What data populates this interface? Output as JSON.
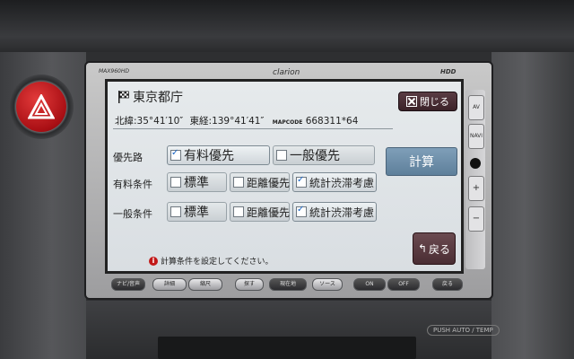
{
  "device": {
    "model": "MAX960HD",
    "brand": "clarion",
    "hdd": "HDD"
  },
  "header": {
    "title": "東京都庁",
    "close_label": "閉じる"
  },
  "location": {
    "lat_label": "北緯:35°41′10″",
    "lon_label": "東経:139°41′41″",
    "mapcode_label": "MAPCODE",
    "mapcode": "668311*64"
  },
  "rows": [
    {
      "label": "優先路",
      "options": [
        {
          "label": "有料優先",
          "checked": true
        },
        {
          "label": "一般優先",
          "checked": false
        }
      ]
    },
    {
      "label": "有料条件",
      "options": [
        {
          "label": "標準",
          "checked": false
        },
        {
          "label": "距離優先",
          "checked": false
        },
        {
          "label": "統計渋滞考慮",
          "checked": true
        }
      ]
    },
    {
      "label": "一般条件",
      "options": [
        {
          "label": "標準",
          "checked": false
        },
        {
          "label": "距離優先",
          "checked": false
        },
        {
          "label": "統計渋滞考慮",
          "checked": true
        }
      ]
    }
  ],
  "actions": {
    "calculate_label": "計算",
    "back_label": "戻る"
  },
  "footer": {
    "message": "計算条件を設定してください。"
  },
  "side_buttons": [
    "AV",
    "NAVI",
    "+",
    "−"
  ],
  "hardware_buttons": [
    "ナビ/音声",
    "詳細",
    "縮尺",
    "探す",
    "現在地",
    "ソース",
    "ON",
    "OFF",
    "戻る"
  ],
  "panel": {
    "push_label": "PUSH AUTO / TEMP"
  },
  "colors": {
    "hazard_red": "#c0141a",
    "screen_bg": "#e2e6e9",
    "calc_button": "#6f8fab",
    "close_button": "#4a2e35"
  }
}
